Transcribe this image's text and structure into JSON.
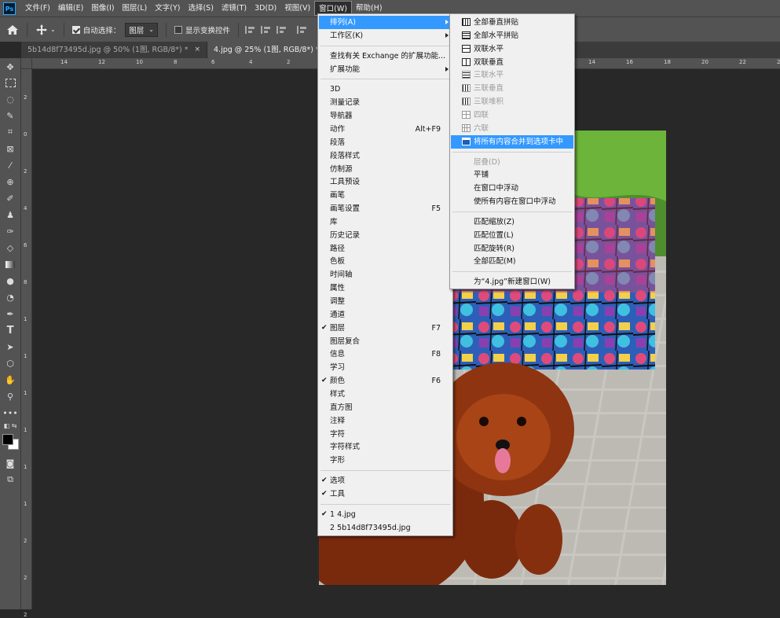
{
  "app": {
    "logo": "Ps",
    "accent": "#3399ff"
  },
  "menubar": [
    {
      "label": "文件(F)"
    },
    {
      "label": "编辑(E)"
    },
    {
      "label": "图像(I)"
    },
    {
      "label": "图层(L)"
    },
    {
      "label": "文字(Y)"
    },
    {
      "label": "选择(S)"
    },
    {
      "label": "滤镜(T)"
    },
    {
      "label": "3D(D)"
    },
    {
      "label": "视图(V)"
    },
    {
      "label": "窗口(W)"
    },
    {
      "label": "帮助(H)"
    }
  ],
  "options": {
    "home_icon": "home-icon",
    "move_icon": "move-icon",
    "auto_select_label": "自动选择：",
    "auto_select_checked": true,
    "auto_select_value": "图层",
    "transform_label": "显示变换控件",
    "transform_checked": false
  },
  "tabs": [
    {
      "label": "5b14d8f73495d.jpg @ 50% (1图, RGB/8*) *",
      "close": "×",
      "active": false
    },
    {
      "label": "4.jpg @ 25% (1图, RGB/8*) *",
      "close": "×",
      "active": true
    }
  ],
  "ruler_h": [
    "14",
    "12",
    "10",
    "8",
    "6",
    "4",
    "2",
    "0",
    "2",
    "4",
    "6",
    "8",
    "10",
    "12",
    "14",
    "16",
    "18",
    "20",
    "22",
    "24"
  ],
  "ruler_v": [
    "2",
    "0",
    "2",
    "4",
    "6",
    "8",
    "1",
    "1",
    "1",
    "1",
    "1",
    "1",
    "2",
    "2",
    "2"
  ],
  "window_menu": {
    "items": [
      {
        "label": "排列(A)",
        "submenu": true,
        "highlighted": true
      },
      {
        "label": "工作区(K)",
        "submenu": true
      },
      {
        "sep": true
      },
      {
        "label": "查找有关 Exchange 的扩展功能..."
      },
      {
        "label": "扩展功能",
        "submenu": true
      },
      {
        "sep": true
      },
      {
        "label": "3D"
      },
      {
        "label": "测量记录"
      },
      {
        "label": "导航器"
      },
      {
        "label": "动作",
        "shortcut": "Alt+F9"
      },
      {
        "label": "段落"
      },
      {
        "label": "段落样式"
      },
      {
        "label": "仿制源"
      },
      {
        "label": "工具预设"
      },
      {
        "label": "画笔"
      },
      {
        "label": "画笔设置",
        "shortcut": "F5"
      },
      {
        "label": "库"
      },
      {
        "label": "历史记录"
      },
      {
        "label": "路径"
      },
      {
        "label": "色板"
      },
      {
        "label": "时间轴"
      },
      {
        "label": "属性"
      },
      {
        "label": "调整"
      },
      {
        "label": "通道"
      },
      {
        "label": "图层",
        "shortcut": "F7",
        "checked": true
      },
      {
        "label": "图层复合"
      },
      {
        "label": "信息",
        "shortcut": "F8"
      },
      {
        "label": "学习"
      },
      {
        "label": "颜色",
        "shortcut": "F6",
        "checked": true
      },
      {
        "label": "样式"
      },
      {
        "label": "直方图"
      },
      {
        "label": "注释"
      },
      {
        "label": "字符"
      },
      {
        "label": "字符样式"
      },
      {
        "label": "字形"
      },
      {
        "sep": true
      },
      {
        "label": "选项",
        "checked": true
      },
      {
        "label": "工具",
        "checked": true
      },
      {
        "sep": true
      },
      {
        "label": "1 4.jpg",
        "checked": true
      },
      {
        "label": "2 5b14d8f73495d.jpg"
      }
    ]
  },
  "arrange_menu": {
    "items": [
      {
        "label": "全部垂直拼贴",
        "icon": "v3"
      },
      {
        "label": "全部水平拼贴",
        "icon": "h3"
      },
      {
        "label": "双联水平",
        "icon": "h2"
      },
      {
        "label": "双联垂直",
        "icon": "v2"
      },
      {
        "label": "三联水平",
        "icon": "h3",
        "disabled": true
      },
      {
        "label": "三联垂直",
        "icon": "v3",
        "disabled": true
      },
      {
        "label": "三联堆积",
        "icon": "v3",
        "disabled": true
      },
      {
        "label": "四联",
        "icon": "g4",
        "disabled": true
      },
      {
        "label": "六联",
        "icon": "g6",
        "disabled": true
      },
      {
        "label": "将所有内容合并到选项卡中",
        "icon": "tab",
        "highlighted": true
      },
      {
        "sep": true
      },
      {
        "label": "层叠(D)",
        "disabled": true
      },
      {
        "label": "平铺"
      },
      {
        "label": "在窗口中浮动"
      },
      {
        "label": "使所有内容在窗口中浮动"
      },
      {
        "sep": true
      },
      {
        "label": "匹配缩放(Z)"
      },
      {
        "label": "匹配位置(L)"
      },
      {
        "label": "匹配旋转(R)"
      },
      {
        "label": "全部匹配(M)"
      },
      {
        "sep": true
      },
      {
        "label": "为“4.jpg”新建窗口(W)"
      }
    ]
  },
  "tools": [
    "move-tool-icon",
    "marquee-tool-icon",
    "lasso-tool-icon",
    "quick-select-icon",
    "crop-tool-icon",
    "frame-tool-icon",
    "eyedropper-icon",
    "healing-brush-icon",
    "brush-tool-icon",
    "stamp-tool-icon",
    "history-brush-icon",
    "eraser-icon",
    "gradient-icon",
    "blur-icon",
    "dodge-icon",
    "pen-tool-icon",
    "type-tool-icon",
    "path-select-icon",
    "shape-tool-icon",
    "hand-tool-icon",
    "zoom-tool-icon",
    "more-tools-icon",
    "swap-colors-icon",
    "color-swatches-icon",
    "quickmask-icon",
    "screen-mode-icon"
  ]
}
